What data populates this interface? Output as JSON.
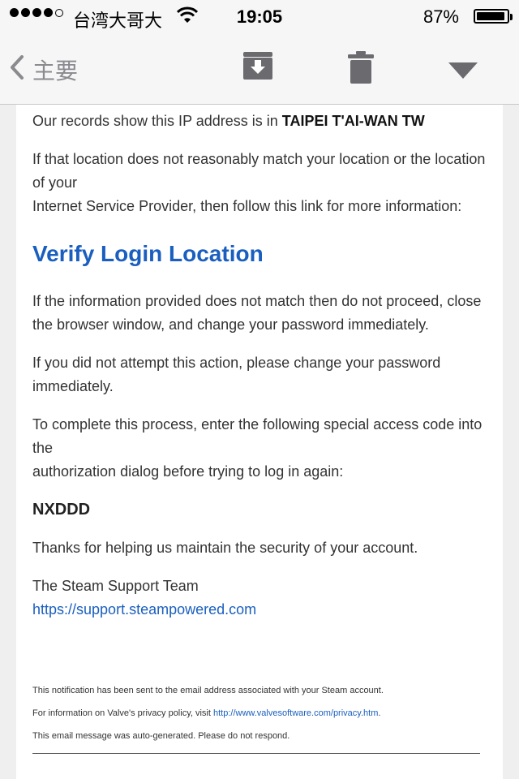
{
  "status_bar": {
    "carrier": "台湾大哥大",
    "time": "19:05",
    "battery": "87%",
    "battery_level": 0.87
  },
  "toolbar": {
    "back_label": "主要",
    "icons": {
      "back": "chevron-left-icon",
      "archive": "archive-box-icon",
      "trash": "trash-icon",
      "reply": "reply-triangle-icon"
    }
  },
  "email": {
    "p1_prefix": "Our records show this IP address is in ",
    "p1_location": "TAIPEI T'AI-WAN TW",
    "p2_line1": "If that location does not reasonably match your location or the location of your",
    "p2_line2": "Internet Service Provider, then follow this link for more information:",
    "verify_link": "Verify Login Location",
    "p3": "If the information provided does not match then do not proceed, close the browser window, and change your password immediately.",
    "p4": "If you did not attempt this action, please change your password immediately.",
    "p5_line1": "To complete this process, enter the following special access code into the",
    "p5_line2": "authorization dialog before trying to log in again:",
    "access_code": "NXDDD",
    "p6": "Thanks for helping us maintain the security of your account.",
    "signature": "The Steam Support Team",
    "support_link": "https://support.steampowered.com",
    "footer1": "This notification has been sent to the email address associated with your Steam account.",
    "footer2_prefix": "For information on Valve's privacy policy, visit ",
    "footer2_link": "http://www.valvesoftware.com/privacy.htm",
    "footer2_suffix": ".",
    "footer3": "This email message was auto-generated. Please do not respond."
  }
}
